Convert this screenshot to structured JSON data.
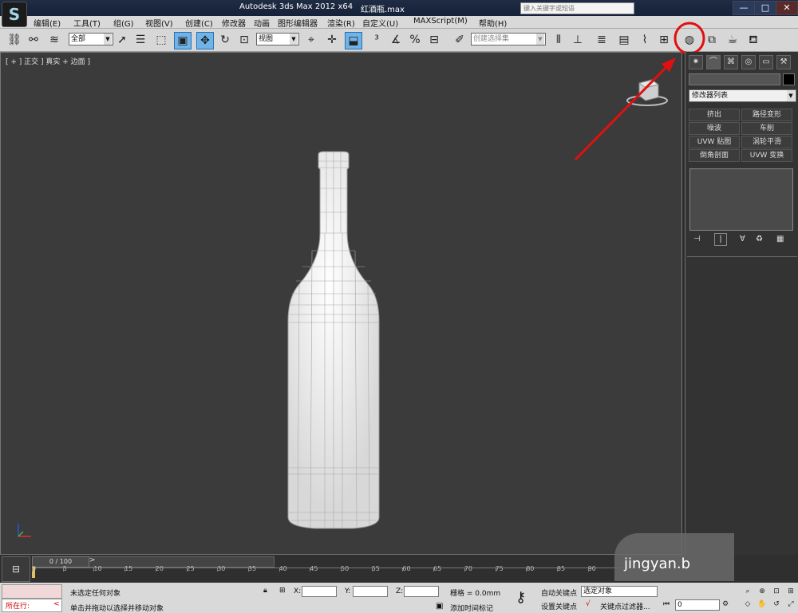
{
  "titlebar": {
    "app_logo": "S",
    "title": "Autodesk 3ds Max  2012 x64",
    "file": "红酒瓶.max",
    "search_placeholder": "键入关键字或短语",
    "win_min": "—",
    "win_max": "□",
    "win_close": "✕"
  },
  "menu": [
    "编辑(E)",
    "工具(T)",
    "组(G)",
    "视图(V)",
    "创建(C)",
    "修改器",
    "动画",
    "图形编辑器",
    "渲染(R)",
    "自定义(U)",
    "MAXScript(M)",
    "帮助(H)"
  ],
  "toolbar": {
    "selection_filter": "全部",
    "reference_coord": "视图",
    "named_selection_placeholder": "创建选择集"
  },
  "viewport": {
    "label": "[ + ] 正交 ] 真实 + 边面 ]"
  },
  "cmdpanel": {
    "modifier_list": "修改器列表",
    "modifiers": [
      "挤出",
      "路径变形",
      "噪波",
      "车削",
      "UVW 贴图",
      "涡轮平滑",
      "倒角剖面",
      "UVW 变换"
    ]
  },
  "timeline": {
    "frame_counter": "0 / 100",
    "ticks": [
      "0",
      "5",
      "10",
      "15",
      "20",
      "25",
      "30",
      "35",
      "40",
      "45",
      "50",
      "55",
      "60",
      "65",
      "70",
      "75",
      "80",
      "85",
      "90"
    ]
  },
  "status": {
    "mini_listener": "所在行:",
    "selection_info": "未选定任何对象",
    "prompt": "单击并拖动以选择并移动对象",
    "x_label": "X:",
    "y_label": "Y:",
    "z_label": "Z:",
    "grid": "栅格 = 0.0mm",
    "add_time_tag": "添加时间标记",
    "auto_key": "自动关键点",
    "set_key": "设置关键点",
    "selected_dd": "选定对象",
    "key_filters": "关键点过滤器...",
    "current_frame": "0"
  },
  "watermark": "jingyan.b",
  "annotation_color": "#e01010"
}
